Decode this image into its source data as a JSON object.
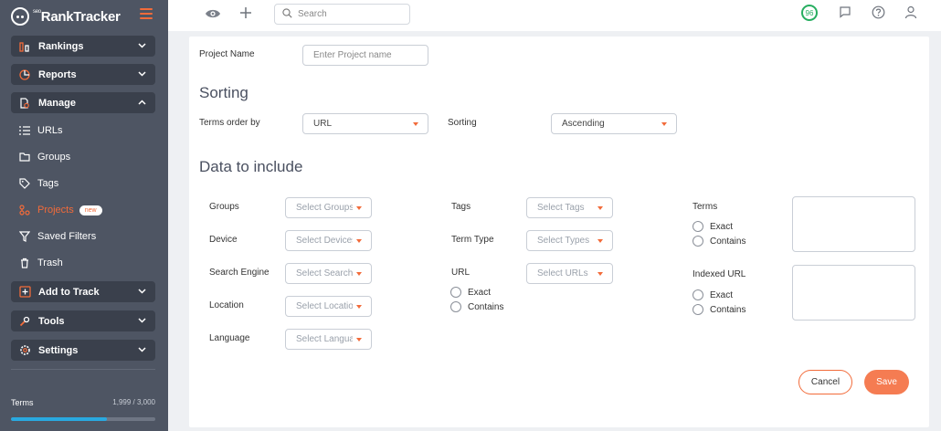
{
  "app": {
    "logo_text": "RankTracker",
    "logo_small": "seo",
    "brand_color": "#f26b3a"
  },
  "sidebar": {
    "rankings": "Rankings",
    "reports": "Reports",
    "manage": "Manage",
    "manage_items": {
      "urls": "URLs",
      "groups": "Groups",
      "tags": "Tags",
      "projects": "Projects",
      "projects_badge": "new",
      "saved_filters": "Saved Filters",
      "trash": "Trash"
    },
    "add_to_track": "Add to Track",
    "tools": "Tools",
    "settings": "Settings",
    "terms_label": "Terms",
    "terms_count": "1,999 / 3,000",
    "terms_progress_fraction": 0.6663
  },
  "topbar": {
    "search_placeholder": "Search",
    "score": "96"
  },
  "form": {
    "project_name_label": "Project Name",
    "project_name_placeholder": "Enter Project name",
    "sorting_title": "Sorting",
    "terms_order_label": "Terms order by",
    "terms_order_value": "URL",
    "sorting_label": "Sorting",
    "sorting_value": "Ascending",
    "data_title": "Data to include",
    "groups_label": "Groups",
    "groups_placeholder": "Select Groups",
    "device_label": "Device",
    "device_placeholder": "Select Devices",
    "engine_label": "Search Engine",
    "engine_placeholder": "Select Search Engines",
    "location_label": "Location",
    "location_placeholder": "Select Locations",
    "language_label": "Language",
    "language_placeholder": "Select Languages",
    "tags_label": "Tags",
    "tags_placeholder": "Select Tags",
    "term_type_label": "Term Type",
    "term_type_placeholder": "Select Types",
    "url_label": "URL",
    "url_placeholder": "Select URLs",
    "url_exact": "Exact",
    "url_contains": "Contains",
    "terms_label": "Terms",
    "terms_exact": "Exact",
    "terms_contains": "Contains",
    "indexed_label": "Indexed URL",
    "indexed_exact": "Exact",
    "indexed_contains": "Contains",
    "cancel": "Cancel",
    "save": "Save"
  }
}
